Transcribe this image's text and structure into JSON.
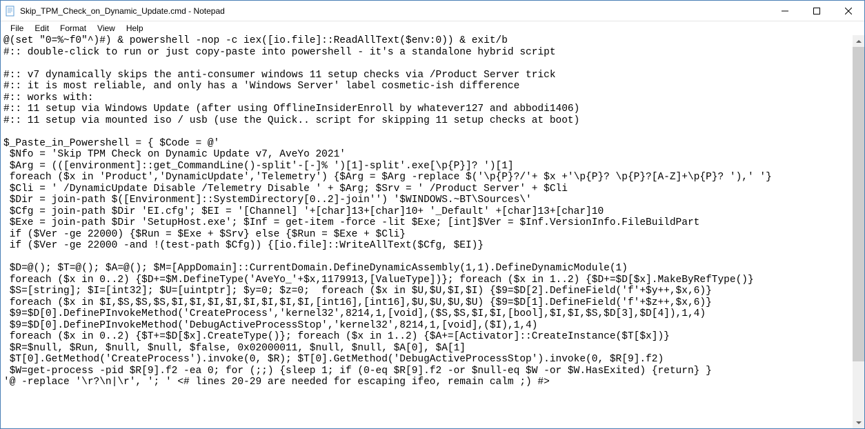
{
  "window": {
    "title": "Skip_TPM_Check_on_Dynamic_Update.cmd - Notepad"
  },
  "menu": {
    "file": "File",
    "edit": "Edit",
    "format": "Format",
    "view": "View",
    "help": "Help"
  },
  "content": "@(set \"0=%~f0\"^)#) & powershell -nop -c iex([io.file]::ReadAllText($env:0)) & exit/b\n#:: double-click to run or just copy-paste into powershell - it's a standalone hybrid script\n\n#:: v7 dynamically skips the anti-consumer windows 11 setup checks via /Product Server trick\n#:: it is most reliable, and only has a 'Windows Server' label cosmetic-ish difference\n#:: works with:\n#:: 11 setup via Windows Update (after using OfflineInsiderEnroll by whatever127 and abbodi1406)\n#:: 11 setup via mounted iso / usb (use the Quick.. script for skipping 11 setup checks at boot)\n\n$_Paste_in_Powershell = { $Code = @'\n $Nfo = 'Skip TPM Check on Dynamic Update v7, AveYo 2021'\n $Arg = (([environment]::get_CommandLine()-split'-[-]% ')[1]-split'.exe[\\p{P}]? ')[1]\n foreach ($x in 'Product','DynamicUpdate','Telemetry') {$Arg = $Arg -replace $('\\p{P}?/'+ $x +'\\p{P}? \\p{P}?[A-Z]+\\p{P}? '),' '}\n $Cli = ' /DynamicUpdate Disable /Telemetry Disable ' + $Arg; $Srv = ' /Product Server' + $Cli\n $Dir = join-path $([Environment]::SystemDirectory[0..2]-join'') '$WINDOWS.~BT\\Sources\\'\n $Cfg = join-path $Dir 'EI.cfg'; $EI = '[Channel] '+[char]13+[char]10+ '_Default' +[char]13+[char]10\n $Exe = join-path $Dir 'SetupHost.exe'; $Inf = get-item -force -lit $Exe; [int]$Ver = $Inf.VersionInfo.FileBuildPart\n if ($Ver -ge 22000) {$Run = $Exe + $Srv} else {$Run = $Exe + $Cli}\n if ($Ver -ge 22000 -and !(test-path $Cfg)) {[io.file]::WriteAllText($Cfg, $EI)}\n\n $D=@(); $T=@(); $A=@(); $M=[AppDomain]::CurrentDomain.DefineDynamicAssembly(1,1).DefineDynamicModule(1)\n foreach ($x in 0..2) {$D+=$M.DefineType('AveYo_'+$x,1179913,[ValueType])}; foreach ($x in 1..2) {$D+=$D[$x].MakeByRefType()}\n $S=[string]; $I=[int32]; $U=[uintptr]; $y=0; $z=0;  foreach ($x in $U,$U,$I,$I) {$9=$D[2].DefineField('f'+$y++,$x,6)}\n foreach ($x in $I,$S,$S,$S,$I,$I,$I,$I,$I,$I,$I,$I,[int16],[int16],$U,$U,$U,$U) {$9=$D[1].DefineField('f'+$z++,$x,6)}\n $9=$D[0].DefinePInvokeMethod('CreateProcess','kernel32',8214,1,[void],($S,$S,$I,$I,[bool],$I,$I,$S,$D[3],$D[4]),1,4)\n $9=$D[0].DefinePInvokeMethod('DebugActiveProcessStop','kernel32',8214,1,[void],($I),1,4)\n foreach ($x in 0..2) {$T+=$D[$x].CreateType()}; foreach ($x in 1..2) {$A+=[Activator]::CreateInstance($T[$x])}\n $R=$null, $Run, $null, $null, $false, 0x02000011, $null, $null, $A[0], $A[1]\n $T[0].GetMethod('CreateProcess').invoke(0, $R); $T[0].GetMethod('DebugActiveProcessStop').invoke(0, $R[9].f2)\n $W=get-process -pid $R[9].f2 -ea 0; for (;;) {sleep 1; if (0-eq $R[9].f2 -or $null-eq $W -or $W.HasExited) {return} }\n'@ -replace '\\r?\\n|\\r', '; ' <# lines 20-29 are needed for escaping ifeo, remain calm ;) #>"
}
